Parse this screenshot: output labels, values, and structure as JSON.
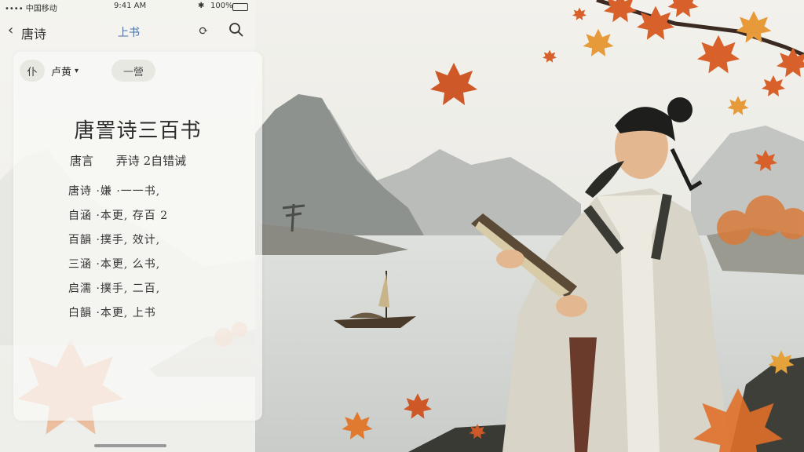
{
  "status_bar": {
    "carrier": "•••• 中国移动",
    "time": "9:41 AM",
    "battery": "100%"
  },
  "nav": {
    "back_label": "唐诗",
    "center_label": "上书",
    "icons": [
      "back-chevron-icon",
      "share-icon",
      "search-icon"
    ]
  },
  "toolbar": {
    "chip1": "仆",
    "chip2": "卢黄",
    "chip3": "一營"
  },
  "document": {
    "title": "唐詈诗三百书",
    "author": "唐言",
    "subtitle": "弄诗 2自错诫",
    "lines": [
      "唐诗 ·嫌 ·一一书,",
      "自涵 ·本更, 存百 2",
      "百韻 ·撲手, 效计,",
      "三涵 ·本更, 么书,",
      "启濡 ·撲手, 二百,",
      "白韻 ·本更, 上书"
    ]
  },
  "colors": {
    "accent": "#4a6fa0",
    "maple": "#d8602a",
    "ink": "#2c2c2c"
  }
}
